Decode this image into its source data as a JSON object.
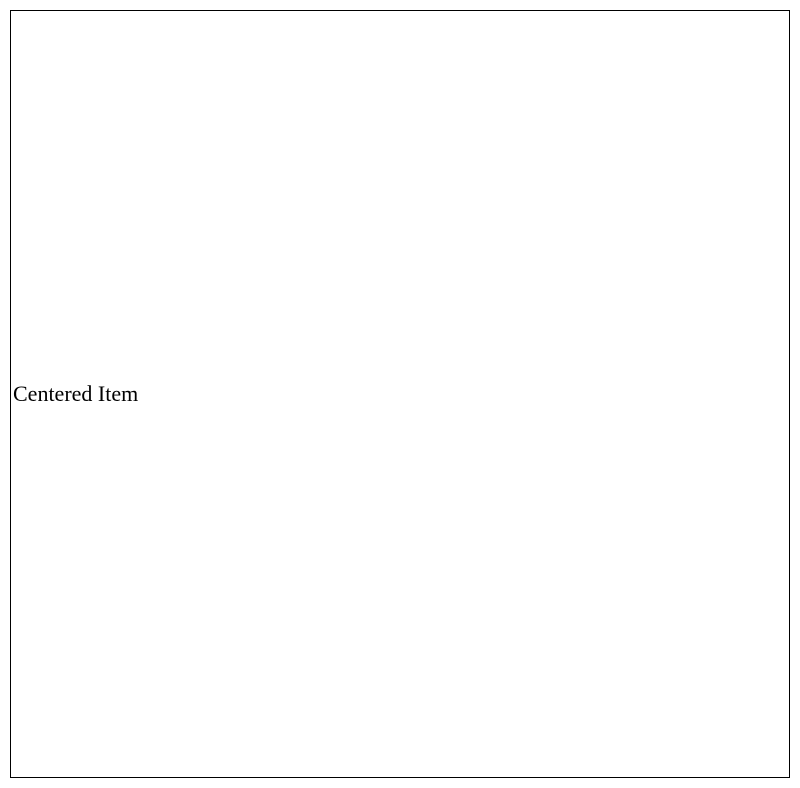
{
  "content": {
    "label": "Centered Item"
  }
}
